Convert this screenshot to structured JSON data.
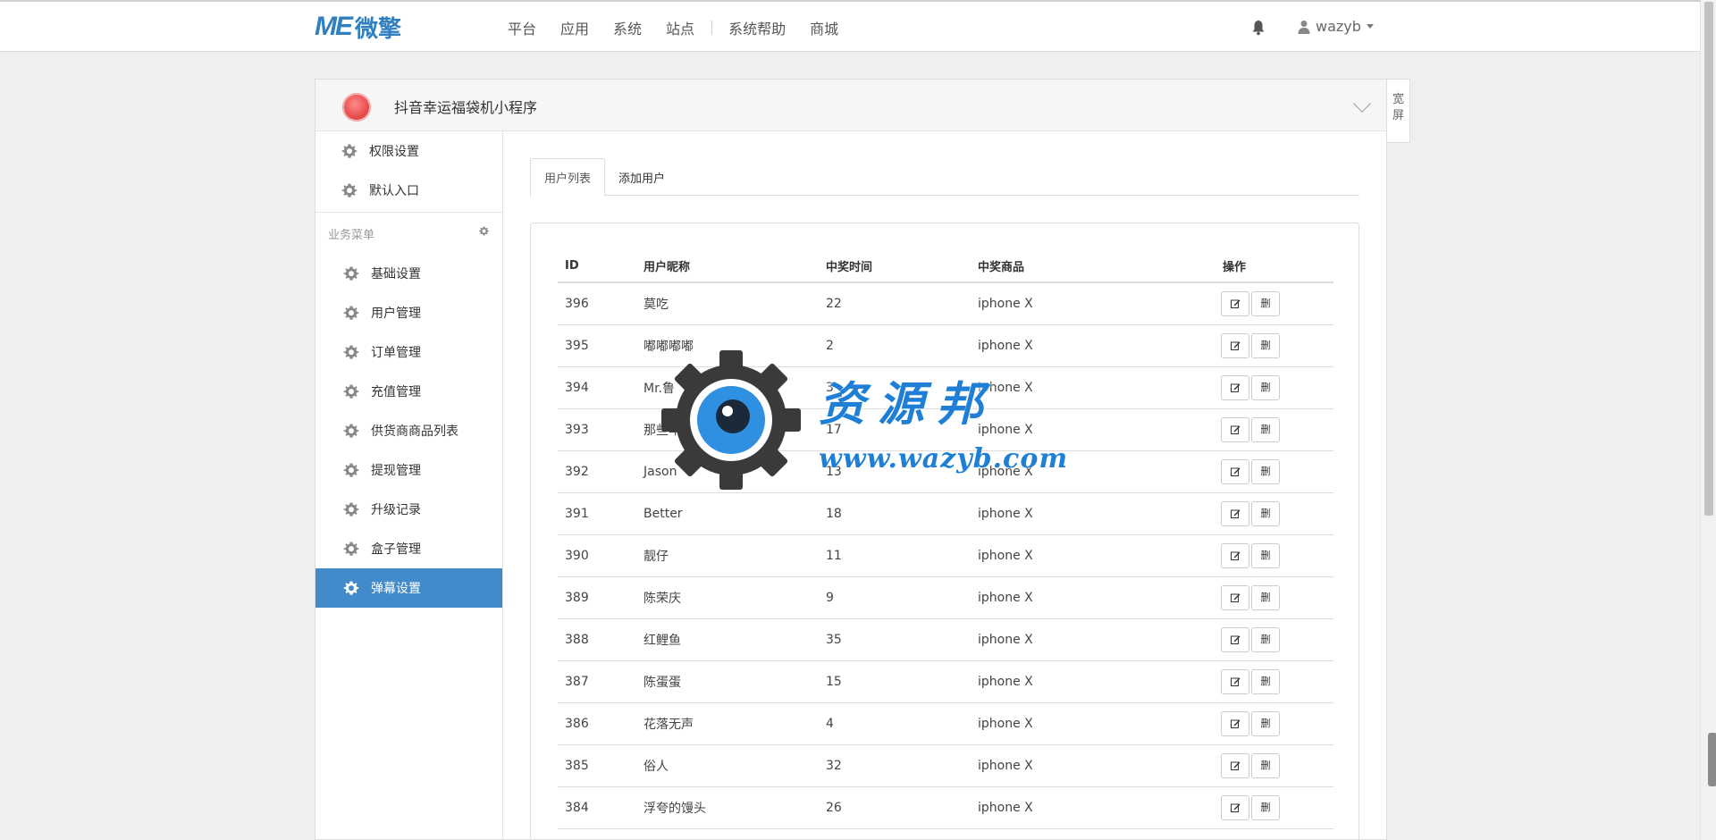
{
  "nav": {
    "logo_mark": "ME",
    "logo_text": "微擎",
    "links": [
      "平台",
      "应用",
      "系统",
      "站点",
      "系统帮助",
      "商城"
    ],
    "username": "wazyb"
  },
  "panel": {
    "app_title": "抖音幸运福袋机小程序",
    "wide_button": "宽屏"
  },
  "sidebar": {
    "top_items": [
      "权限设置",
      "默认入口"
    ],
    "section_title": "业务菜单",
    "items": [
      "基础设置",
      "用户管理",
      "订单管理",
      "充值管理",
      "供货商商品列表",
      "提现管理",
      "升级记录",
      "盒子管理",
      "弹幕设置"
    ],
    "active_index": 8
  },
  "tabs": [
    "用户列表",
    "添加用户"
  ],
  "table": {
    "headers": [
      "ID",
      "用户昵称",
      "中奖时间",
      "中奖商品",
      "操作"
    ],
    "edit_icon": "edit-icon",
    "delete_label": "删",
    "rows": [
      [
        "396",
        "莫吃",
        "22",
        "iphone X"
      ],
      [
        "395",
        "嘟嘟嘟嘟",
        "2",
        "iphone X"
      ],
      [
        "394",
        "Mr.鲁",
        "3",
        "iphone X"
      ],
      [
        "393",
        "那些年",
        "17",
        "iphone X"
      ],
      [
        "392",
        "Jason",
        "13",
        "iphone X"
      ],
      [
        "391",
        "Better",
        "18",
        "iphone X"
      ],
      [
        "390",
        "靓仔",
        "11",
        "iphone X"
      ],
      [
        "389",
        "陈荣庆",
        "9",
        "iphone X"
      ],
      [
        "388",
        "红鲤鱼",
        "35",
        "iphone X"
      ],
      [
        "387",
        "陈蛋蛋",
        "15",
        "iphone X"
      ],
      [
        "386",
        "花落无声",
        "4",
        "iphone X"
      ],
      [
        "385",
        "俗人",
        "32",
        "iphone X"
      ],
      [
        "384",
        "浮夸的馒头",
        "26",
        "iphone X"
      ]
    ]
  },
  "watermark": {
    "title": "资源邦",
    "url": "www.wazyb.com"
  },
  "colors": {
    "brand": "#2f7fc1",
    "active_menu": "#428bca",
    "watermark": "#1f7fd6"
  }
}
